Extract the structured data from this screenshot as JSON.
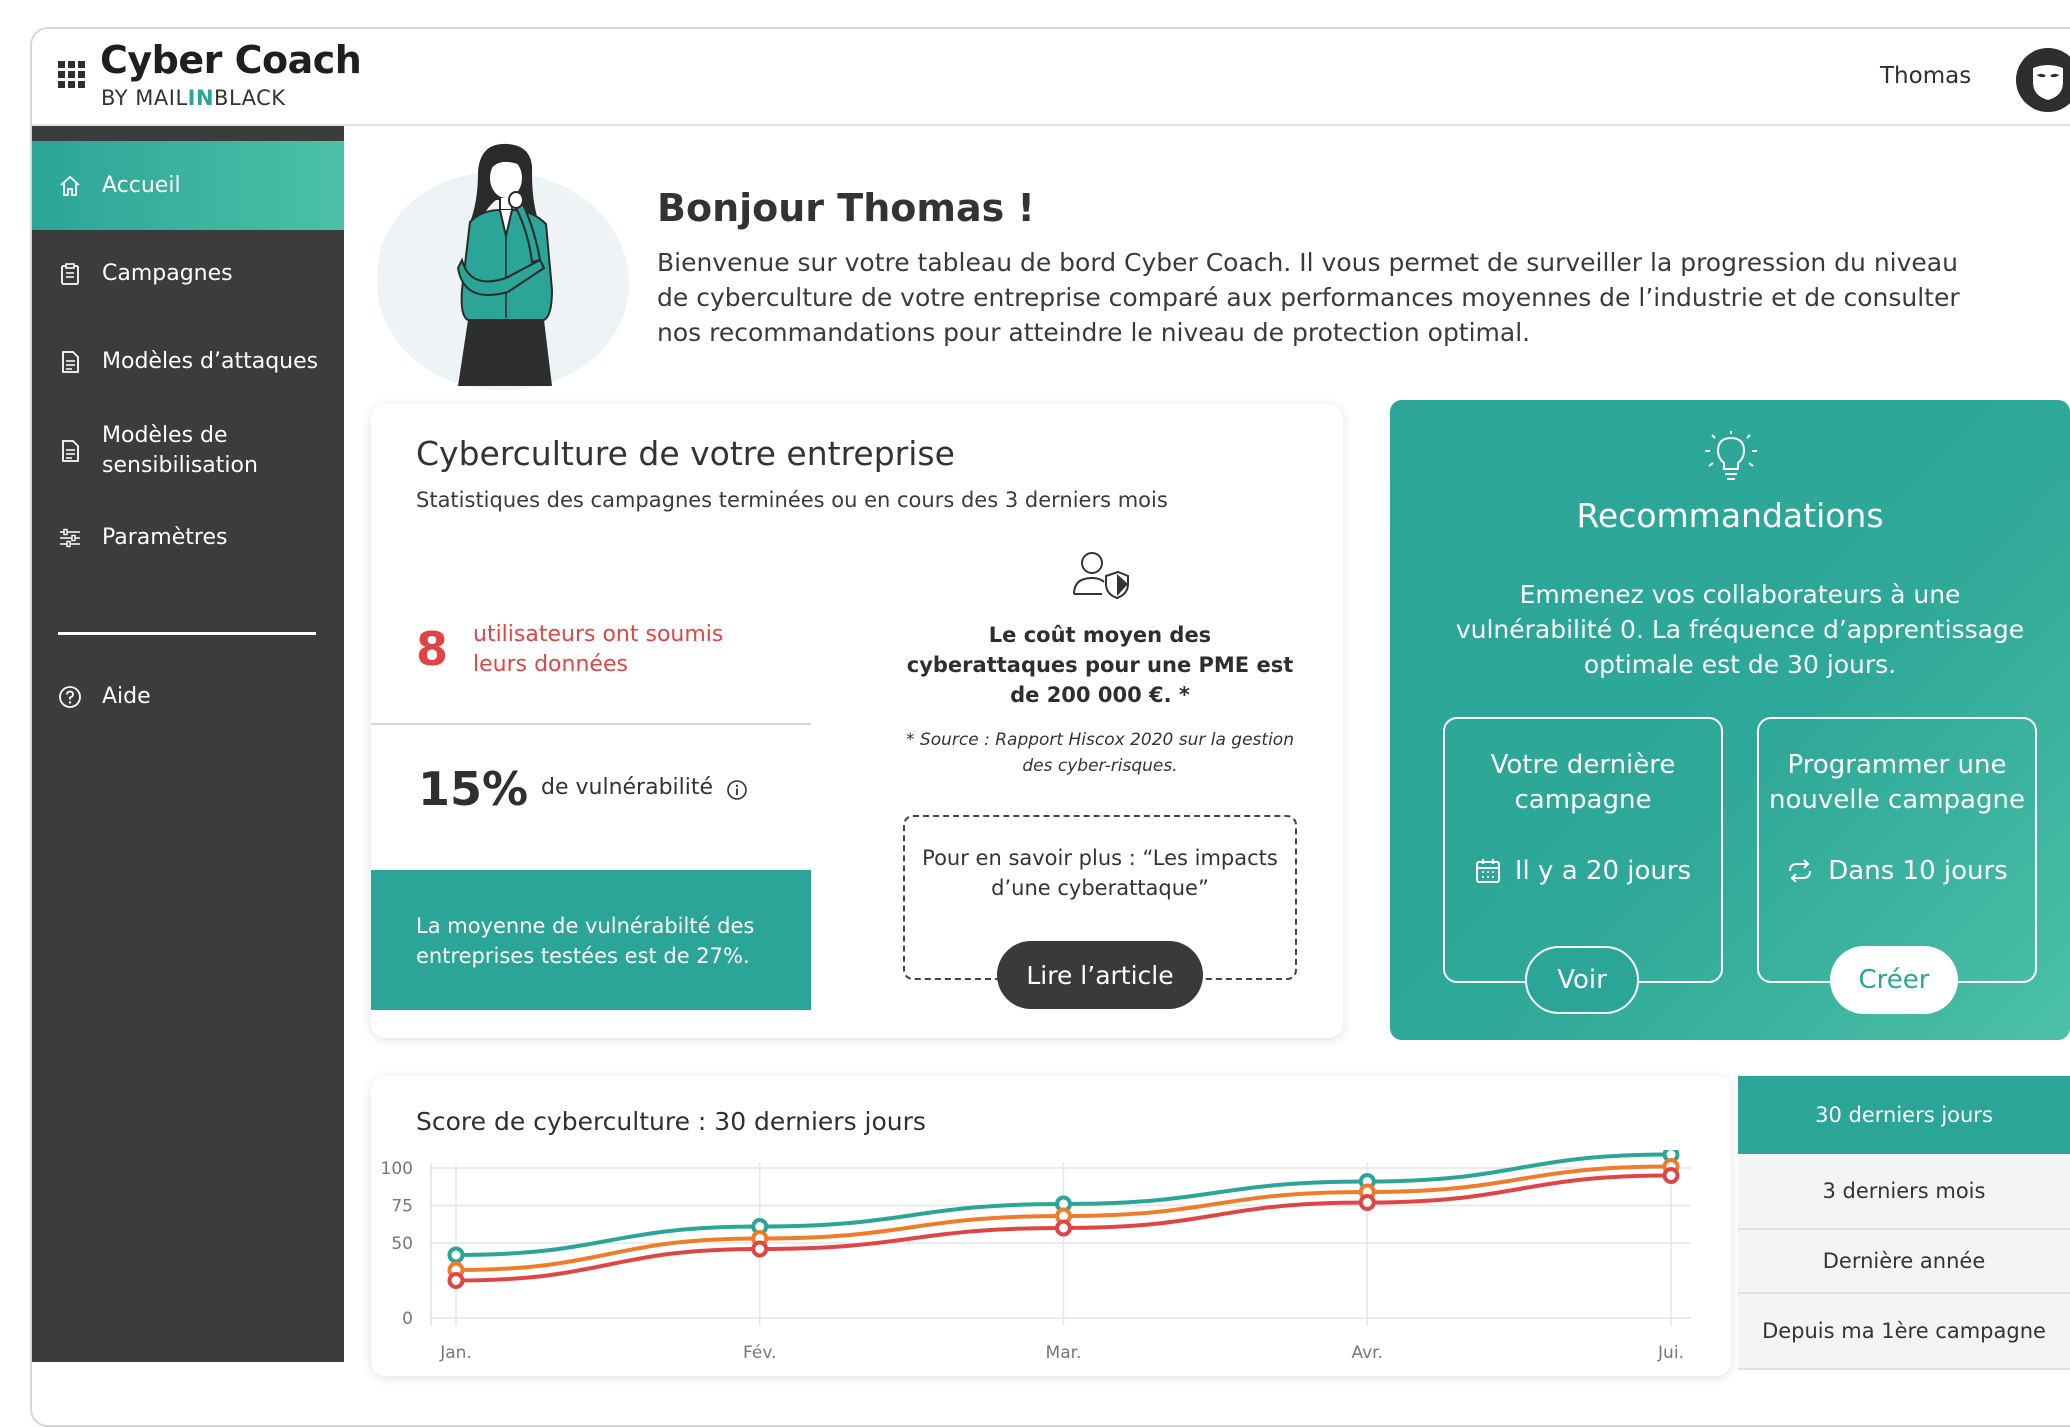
{
  "header": {
    "brand_title": "Cyber Coach",
    "brand_sub_prefix": "BY MAIL",
    "brand_sub_highlight": "IN",
    "brand_sub_suffix": "BLACK",
    "user_name": "Thomas"
  },
  "sidebar": {
    "items": [
      {
        "label": "Accueil",
        "icon": "home-icon",
        "active": true
      },
      {
        "label": "Campagnes",
        "icon": "clipboard-icon"
      },
      {
        "label": "Modèles d’attaques",
        "icon": "document-icon"
      },
      {
        "label": "Modèles de sensibilisation",
        "icon": "document-icon"
      },
      {
        "label": "Paramètres",
        "icon": "sliders-icon"
      }
    ],
    "help_label": "Aide"
  },
  "hero": {
    "greeting": "Bonjour Thomas !",
    "intro": "Bienvenue sur votre tableau de bord Cyber Coach. Il vous permet de surveiller la progression du niveau de cyberculture de votre entreprise comparé aux performances moyennes de l’industrie et de consulter nos recommandations pour atteindre le niveau de protection optimal."
  },
  "cyberculture": {
    "title": "Cyberculture de votre entreprise",
    "subtitle": "Statistiques des campagnes terminées ou en cours des 3 derniers mois",
    "submitted_count": "8",
    "submitted_text": "utilisateurs ont soumis leurs données",
    "vulnerability_pct": "15%",
    "vulnerability_label": "de vulnérabilité",
    "average_text": "La moyenne de vulnérabilté des entreprises testées est de 27%.",
    "cost_text": "Le coût moyen des cyberattaques pour une PME est de 200 000 €. *",
    "source_text": "* Source : Rapport Hiscox 2020 sur la gestion des cyber-risques.",
    "more_text": "Pour en savoir plus : “Les impacts d’une cyberattaque”",
    "read_button": "Lire l’article"
  },
  "recommendations": {
    "title": "Recommandations",
    "text": "Emmenez vos collaborateurs à une vulnérabilité 0. La fréquence d’apprentissage optimale est de 30 jours.",
    "last_campaign": {
      "title": "Votre dernière campagne",
      "meta": "Il y a 20 jours",
      "button": "Voir"
    },
    "new_campaign": {
      "title": "Programmer une nouvelle campagne",
      "meta": "Dans 10 jours",
      "button": "Créer"
    }
  },
  "score": {
    "title": "Score de cyberculture : 30 derniers jours"
  },
  "periods": [
    {
      "label": "30 derniers jours",
      "active": true
    },
    {
      "label": "3 derniers mois"
    },
    {
      "label": "Dernière année"
    },
    {
      "label": "Depuis ma 1ère campagne"
    }
  ],
  "colors": {
    "accent": "#2aa597",
    "sidebar": "#3c3c3c",
    "alert": "#e04545",
    "series_orange": "#ef7c2a"
  },
  "chart_data": {
    "type": "line",
    "x": [
      "Jan.",
      "Fév.",
      "Mar.",
      "Avr.",
      "Jui."
    ],
    "yticks": [
      0,
      50,
      75,
      100
    ],
    "ylim": [
      0,
      100
    ],
    "grid": true,
    "series": [
      {
        "color": "#2aa597",
        "values": [
          42,
          61,
          76,
          91,
          109
        ]
      },
      {
        "color": "#ef7c2a",
        "values": [
          32,
          53,
          68,
          84,
          101
        ]
      },
      {
        "color": "#e04545",
        "values": [
          25,
          46,
          60,
          77,
          95
        ]
      }
    ]
  }
}
